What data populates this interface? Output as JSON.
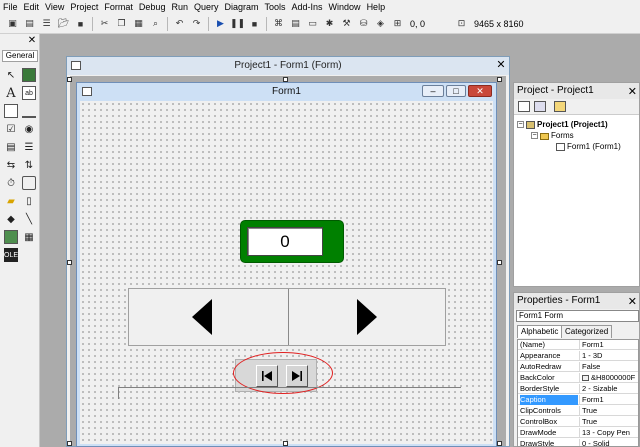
{
  "menu": {
    "items": [
      "File",
      "Edit",
      "View",
      "Project",
      "Format",
      "Debug",
      "Run",
      "Query",
      "Diagram",
      "Tools",
      "Add-Ins",
      "Window",
      "Help"
    ]
  },
  "toolbar": {
    "position": "0, 0",
    "size": "9465 x 8160"
  },
  "toolbox": {
    "tab_label": "General"
  },
  "designer": {
    "title": "Project1 - Form1 (Form)"
  },
  "form": {
    "title": "Form1",
    "counter_value": "0"
  },
  "project_panel": {
    "title": "Project - Project1",
    "tree": {
      "root": "Project1 (Project1)",
      "folder": "Forms",
      "item": "Form1 (Form1)"
    }
  },
  "properties_panel": {
    "title": "Properties - Form1",
    "combo": "Form1  Form",
    "tabs": [
      "Alphabetic",
      "Categorized"
    ],
    "rows": [
      {
        "name": "(Name)",
        "value": "Form1"
      },
      {
        "name": "Appearance",
        "value": "1 - 3D"
      },
      {
        "name": "AutoRedraw",
        "value": "False"
      },
      {
        "name": "BackColor",
        "value": "&H8000000F"
      },
      {
        "name": "BorderStyle",
        "value": "2 - Sizable"
      },
      {
        "name": "Caption",
        "value": "Form1"
      },
      {
        "name": "ClipControls",
        "value": "True"
      },
      {
        "name": "ControlBox",
        "value": "True"
      },
      {
        "name": "DrawMode",
        "value": "13 - Copy Pen"
      },
      {
        "name": "DrawStyle",
        "value": "0 - Solid"
      }
    ],
    "selected_row": "Caption"
  },
  "colors": {
    "counter_green": "#008000",
    "highlight_red": "#e02020",
    "selection_blue": "#3399ff"
  }
}
